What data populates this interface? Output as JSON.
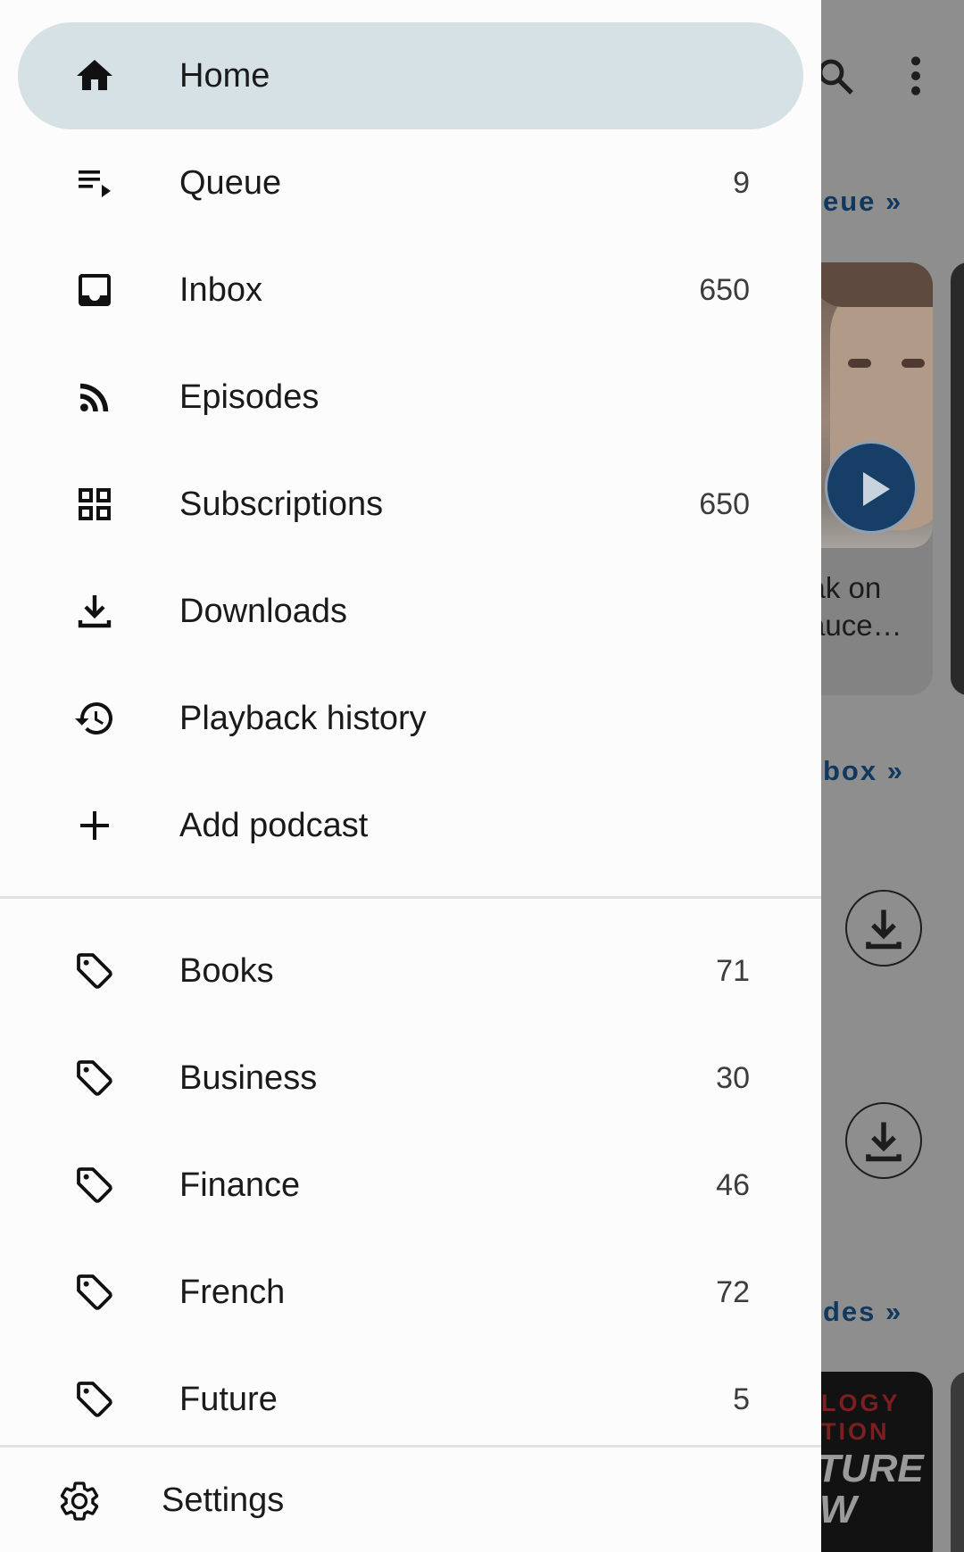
{
  "drawer": {
    "nav_items": [
      {
        "label": "Home",
        "count": "",
        "icon": "home-icon"
      },
      {
        "label": "Queue",
        "count": "9",
        "icon": "queue-icon"
      },
      {
        "label": "Inbox",
        "count": "650",
        "icon": "inbox-icon"
      },
      {
        "label": "Episodes",
        "count": "",
        "icon": "rss-icon"
      },
      {
        "label": "Subscriptions",
        "count": "650",
        "icon": "grid-icon"
      },
      {
        "label": "Downloads",
        "count": "",
        "icon": "download-icon"
      },
      {
        "label": "Playback history",
        "count": "",
        "icon": "history-icon"
      },
      {
        "label": "Add podcast",
        "count": "",
        "icon": "plus-icon"
      }
    ],
    "tags": [
      {
        "label": "Books",
        "count": "71",
        "icon": "tag-icon"
      },
      {
        "label": "Business",
        "count": "30",
        "icon": "tag-icon"
      },
      {
        "label": "Finance",
        "count": "46",
        "icon": "tag-icon"
      },
      {
        "label": "French",
        "count": "72",
        "icon": "tag-icon"
      },
      {
        "label": "Future",
        "count": "5",
        "icon": "tag-icon"
      }
    ],
    "settings_label": "Settings"
  },
  "background": {
    "queue_link": "eue »",
    "inbox_link": "box »",
    "episodes_link": "des »",
    "episode_title_line1": "vak on",
    "episode_title_line2": "Sauce…",
    "cover_line1": "LOGY",
    "cover_line2": "TION",
    "cover_line3": "TURE",
    "cover_line4": "W"
  },
  "colors": {
    "drawer_bg": "#fcfcfd",
    "active_bg": "#d6e1e5",
    "scrim": "#8e8e8e",
    "accent": "#11385e"
  }
}
